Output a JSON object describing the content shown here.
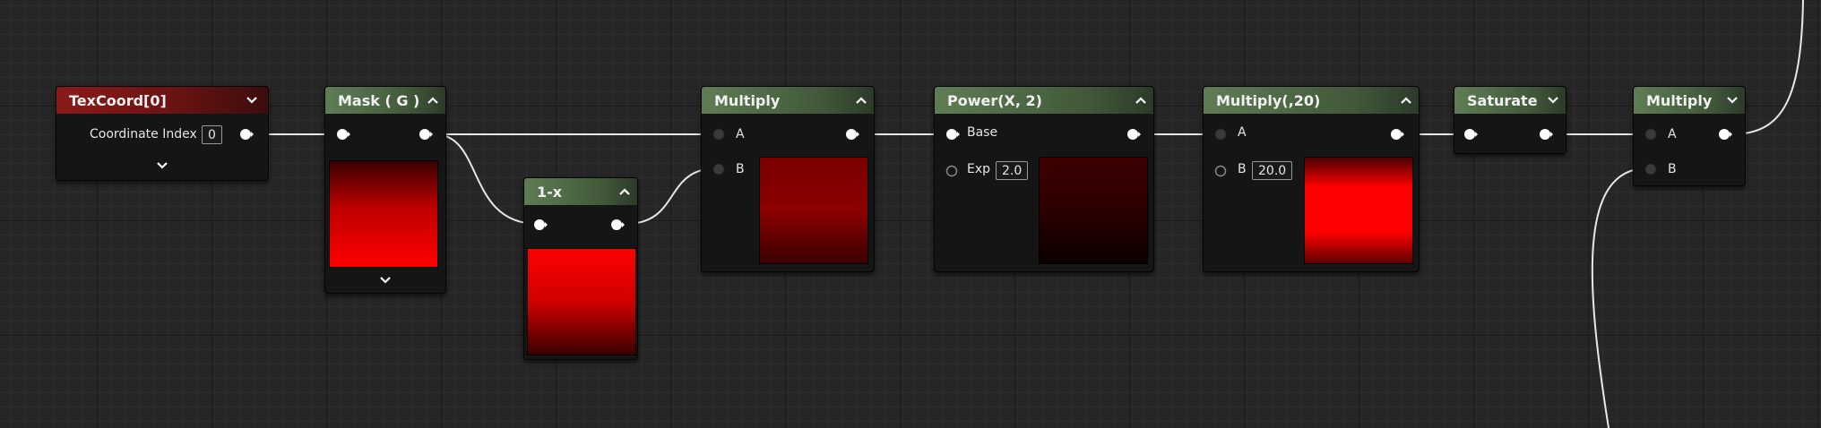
{
  "nodes": {
    "texcoord": {
      "title": "TexCoord[0]",
      "coord_label": "Coordinate Index",
      "coord_value": "0"
    },
    "mask": {
      "title": "Mask ( G )"
    },
    "one_minus": {
      "title": "1-x"
    },
    "multiply1": {
      "title": "Multiply",
      "pin_a": "A",
      "pin_b": "B"
    },
    "power": {
      "title": "Power(X, 2)",
      "pin_base": "Base",
      "pin_exp": "Exp",
      "exp_value": "2.0"
    },
    "multiply20": {
      "title": "Multiply(,20)",
      "pin_a": "A",
      "pin_b": "B",
      "b_value": "20.0"
    },
    "saturate": {
      "title": "Saturate"
    },
    "multiply2": {
      "title": "Multiply",
      "pin_a": "A",
      "pin_b": "B"
    }
  },
  "colors": {
    "header_green": "#5f7d55",
    "header_red": "#8b1a1a",
    "wire": "#e8e8e8",
    "preview_red": "#ff0000"
  },
  "icons": [
    "chevron-up-icon",
    "chevron-down-icon",
    "exec-pin-icon",
    "input-pin-icon"
  ]
}
